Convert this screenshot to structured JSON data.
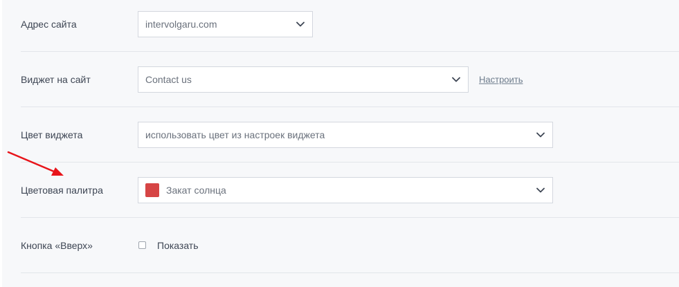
{
  "form": {
    "site": {
      "label": "Адрес сайта",
      "value": "intervolgaru.com"
    },
    "widget": {
      "label": "Виджет на сайт",
      "value": "Contact us",
      "configure_link": "Настроить"
    },
    "widget_color": {
      "label": "Цвет виджета",
      "value": "использовать цвет из настроек виджета"
    },
    "palette": {
      "label": "Цветовая палитра",
      "value": "Закат солнца",
      "swatch_color": "#d64545"
    },
    "scroll_up": {
      "label": "Кнопка «Вверх»",
      "checkbox_label": "Показать",
      "checked": false
    }
  },
  "colors": {
    "annotation_arrow": "#e8141a",
    "panel_background": "#f7f8fa",
    "divider": "#e2e5ea"
  }
}
